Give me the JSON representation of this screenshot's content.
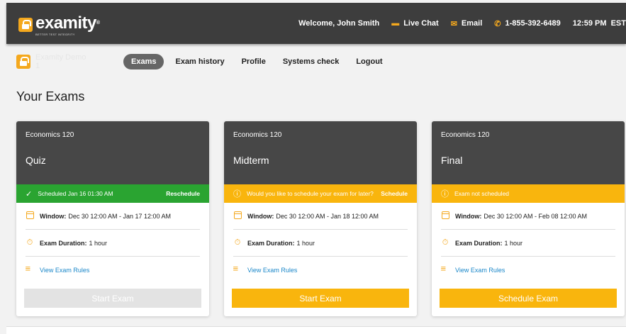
{
  "header": {
    "logo_text": "examity",
    "logo_tagline": "BETTER TEST INTEGRITY",
    "welcome": "Welcome, John Smith",
    "live_chat": "Live Chat",
    "email": "Email",
    "phone": "1-855-392-6489",
    "time": "12:59 PM  EST"
  },
  "nav": {
    "brand": "Examity Demo 1",
    "items": [
      "Exams",
      "Exam history",
      "Profile",
      "Systems check",
      "Logout"
    ]
  },
  "page_title": "Your Exams",
  "cards": [
    {
      "course": "Economics 120",
      "name": "Quiz",
      "status_text": "Scheduled Jan 16 01:30 AM",
      "status_action": "Reschedule",
      "status_color": "#2aa431",
      "window_label": "Window:",
      "window_value": "Dec 30 12:00 AM - Jan 17 12:00 AM",
      "duration_label": "Exam Duration:",
      "duration_value": "1 hour",
      "rules_link": "View Exam Rules",
      "button": "Start Exam",
      "button_state": "disabled"
    },
    {
      "course": "Economics 120",
      "name": "Midterm",
      "status_text": "Would you like to schedule your exam for later?",
      "status_action": "Schedule",
      "status_color": "#f9b50d",
      "window_label": "Window:",
      "window_value": "Dec 30 12:00 AM - Jan 18 12:00 AM",
      "duration_label": "Exam Duration:",
      "duration_value": "1 hour",
      "rules_link": "View Exam Rules",
      "button": "Start Exam",
      "button_state": "primary"
    },
    {
      "course": "Economics 120",
      "name": "Final",
      "status_text": "Exam not scheduled",
      "status_action": "",
      "status_color": "#f9b50d",
      "window_label": "Window:",
      "window_value": "Dec 30 12:00 AM - Feb 08 12:00 AM",
      "duration_label": "Exam Duration:",
      "duration_value": "1 hour",
      "rules_link": "View Exam Rules",
      "button": "Schedule Exam",
      "button_state": "primary"
    }
  ],
  "colors": {
    "accent": "#f4a81d",
    "topbar": "#3d3d3d",
    "card_header": "#474747",
    "link": "#1a87c9"
  }
}
